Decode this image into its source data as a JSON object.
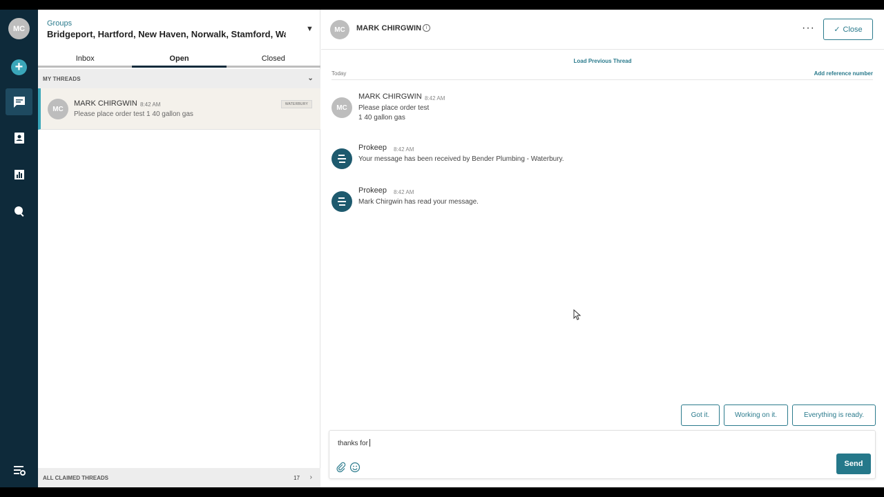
{
  "user": {
    "initials": "MC"
  },
  "nav": {
    "add_label": "+",
    "items": [
      "messages-icon",
      "contacts-icon",
      "reports-icon",
      "search-icon",
      "settings-icon"
    ],
    "accent": "#3aa6b9",
    "background": "#0e2a3a"
  },
  "threads_panel": {
    "groups_label": "Groups",
    "groups_value": "Bridgeport, Hartford, New Haven, Norwalk, Stamford, Waterbury",
    "tabs": [
      {
        "label": "Inbox"
      },
      {
        "label": "Open"
      },
      {
        "label": "Closed"
      }
    ],
    "active_tab": "Open",
    "my_threads_label": "MY THREADS",
    "thread": {
      "initials": "MC",
      "name": "MARK CHIRGWIN",
      "time": "8:42 AM",
      "preview": "Please place order test 1 40 gallon gas",
      "badge": "WATERBURY"
    },
    "claimed_label": "ALL CLAIMED THREADS",
    "claimed_count": "17"
  },
  "conversation": {
    "header": {
      "initials": "MC",
      "name": "MARK CHIRGWIN",
      "info_label": "i",
      "more_label": "···",
      "close_label": "Close"
    },
    "load_previous": "Load Previous Thread",
    "day_label": "Today",
    "add_reference": "Add reference number",
    "messages": [
      {
        "initials": "MC",
        "sender": "MARK CHIRGWIN",
        "time": "8:42 AM",
        "text": "Please place order test\n1 40 gallon gas"
      },
      {
        "initials": "",
        "sender": "Prokeep",
        "time": "8:42 AM",
        "text": "Your message has been received by Bender Plumbing - Waterbury."
      },
      {
        "initials": "",
        "sender": "Prokeep",
        "time": "8:42 AM",
        "text": "Mark Chirgwin has read your message."
      }
    ],
    "quick_replies": [
      "Got it.",
      "Working on it.",
      "Everything is ready."
    ],
    "composer": {
      "value": "thanks for",
      "send_label": "Send"
    }
  }
}
